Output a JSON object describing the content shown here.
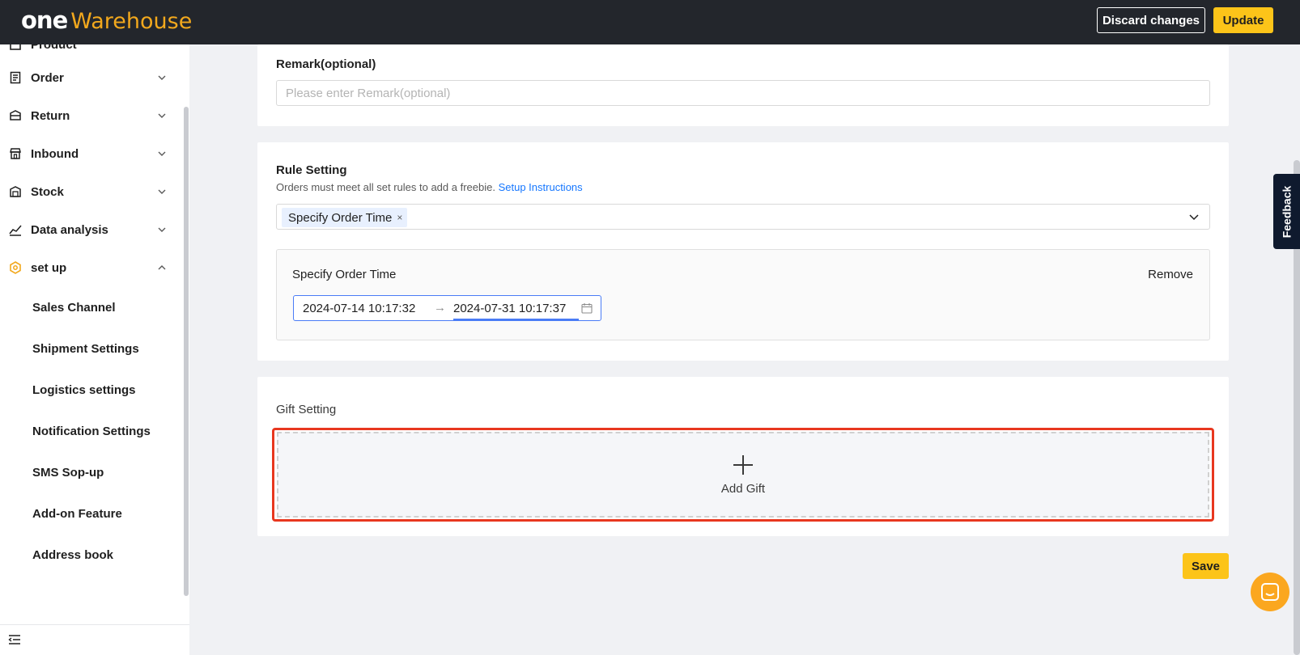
{
  "header": {
    "logo_one": "one",
    "logo_warehouse": "Warehouse",
    "discard_label": "Discard changes",
    "update_label": "Update"
  },
  "sidebar": {
    "partial_item": "Product",
    "items": [
      {
        "label": "Order",
        "icon": "order-icon"
      },
      {
        "label": "Return",
        "icon": "return-icon"
      },
      {
        "label": "Inbound",
        "icon": "inbound-icon"
      },
      {
        "label": "Stock",
        "icon": "stock-icon"
      },
      {
        "label": "Data analysis",
        "icon": "chart-icon"
      },
      {
        "label": "set up",
        "icon": "setup-icon"
      }
    ],
    "sub_items": [
      {
        "label": "Sales Channel"
      },
      {
        "label": "Shipment Settings"
      },
      {
        "label": "Logistics settings"
      },
      {
        "label": "Notification Settings"
      },
      {
        "label": "SMS Sop-up"
      },
      {
        "label": "Add-on Feature"
      },
      {
        "label": "Address book"
      }
    ]
  },
  "remark": {
    "label": "Remark(optional)",
    "placeholder": "Please enter Remark(optional)"
  },
  "rule_setting": {
    "title": "Rule Setting",
    "hint": "Orders must meet all set rules to add a freebie.",
    "hint_link": "Setup Instructions",
    "selected_tag": "Specify Order Time",
    "tag_close": "×",
    "rule": {
      "title": "Specify Order Time",
      "remove_label": "Remove",
      "start": "2024-07-14 10:17:32",
      "arrow": "→",
      "end": "2024-07-31 10:17:37"
    }
  },
  "gift_setting": {
    "title": "Gift Setting",
    "add_label": "Add Gift"
  },
  "footer": {
    "save_label": "Save"
  },
  "feedback_label": "Feedback",
  "colors": {
    "brand_yellow": "#fcc419",
    "header_bg": "#23262c",
    "link_blue": "#1677ff",
    "highlight_red": "#e8371f",
    "chat_orange": "#fba71f"
  }
}
